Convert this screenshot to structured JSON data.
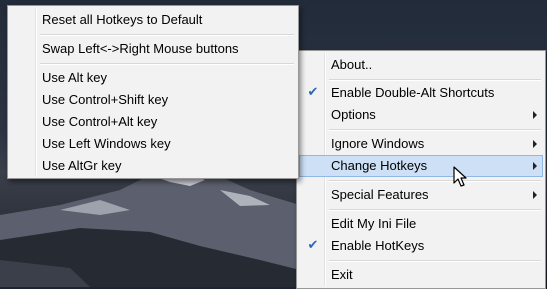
{
  "hotkeys_submenu": {
    "reset_default": "Reset all Hotkeys to Default",
    "swap_mouse": "Swap Left<->Right Mouse buttons",
    "use_alt": "Use Alt key",
    "use_ctrl_shift": "Use Control+Shift key",
    "use_ctrl_alt": "Use Control+Alt key",
    "use_left_windows": "Use Left Windows key",
    "use_altgr": "Use AltGr key"
  },
  "main_menu": {
    "about": "About..",
    "enable_double_alt": "Enable Double-Alt Shortcuts",
    "options": "Options",
    "ignore_windows": "Ignore Windows",
    "change_hotkeys": "Change Hotkeys",
    "special_features": "Special Features",
    "edit_ini": "Edit My Ini File",
    "enable_hotkeys": "Enable HotKeys",
    "exit": "Exit"
  },
  "icons": {
    "check": "check-icon",
    "submenu_arrow": "chevron-right-icon",
    "cursor": "mouse-pointer-icon"
  },
  "colors": {
    "menu_bg": "#f2f2f2",
    "highlight_bg": "#cde0f5",
    "highlight_border": "#90b8e2",
    "check": "#2b64b8"
  }
}
